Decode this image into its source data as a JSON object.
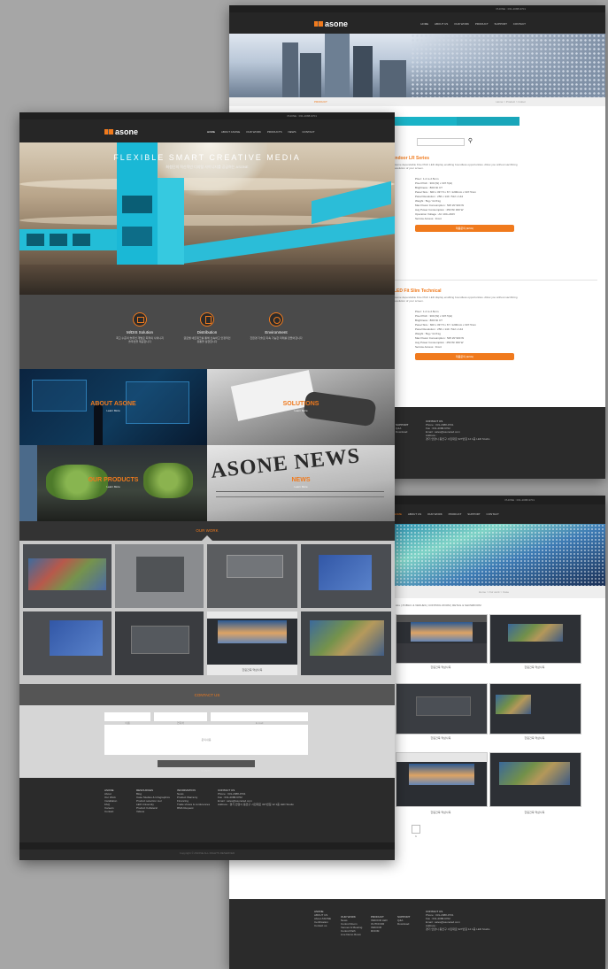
{
  "top_right_page": {
    "phone_bar": "PHONE : 031-2088-9701",
    "logo_word": "asone",
    "nav": [
      "HOME",
      "ABOUT US",
      "OUR WORK",
      "PRODUCT",
      "SUPPORT",
      "CONTACT"
    ],
    "breadcrumb_left": "PRODUCT",
    "breadcrumb_right": "Home > Product > Indoor",
    "tabs": [
      "INDOOR",
      "OUTDOOR"
    ],
    "product1_title": "Indoor LR Series",
    "product1_desc": "Asone dependable Fine Pitch LED display enabling boundless opportunities. Allow you without sacrificing resolution of your screen.",
    "product1_specs": [
      "Pixel : 1.2 to 2.5mm",
      "Pixel Pitch : 300 (W) x 337.5(H)",
      "Brightness : 800 Nit CT",
      "Panel Size : 600 x 337.5 x 67 / 1200mm x 337.5mm",
      "Panel Resolution : 256 x 144 / 512 x 144",
      "Weight : 5kg / 11.8 kg",
      "Max Power Consumption : 525 W/ 900 W",
      "Avg Power Consumption : 250 W/ 300 W",
      "Operation Voltage : AC 100~240V",
      "Service Access : Front"
    ],
    "product1_button": "제품문의 (ENG)",
    "product2_title": "LED Fit Slim Technical",
    "product2_desc": "Asone dependable Fine Pitch LED display enabling boundless opportunities. Allow you without sacrificing resolution of your screen.",
    "product2_specs": [
      "Pixel : 1.2 to 2.5mm",
      "Pixel Pitch : 300 (W) x 337.5(H)",
      "Brightness : 800 Nit CT",
      "Panel Size : 600 x 337.5 x 67 / 1200mm x 337.5mm",
      "Panel Resolution : 256 x 144 / 512 x 144",
      "Weight : 5kg / 11.8 kg",
      "Max Power Consumption : 525 W/ 900 W",
      "Avg Power Consumption : 250 W/ 300 W",
      "Service Access : Front"
    ],
    "product2_button": "제품문의 (ENG)",
    "footer_col1_title": "SUPPORT",
    "footer_col1_items": [
      "Q&A",
      "Download"
    ],
    "footer_col2_title": "CONTACT US",
    "footer_col2_items": [
      "Phone : 031-2088-9701",
      "Fax : 031-2088-9702",
      "Email : sales@asoneled.com",
      "Address :",
      "경기 안양시 동안구 시민대로 327번길 12 1층 LED Studio"
    ]
  },
  "bottom_right_page": {
    "phone_bar": "PHONE : 031-2088-9701",
    "nav": [
      "HOME",
      "ABOUT US",
      "OUR WORK",
      "PRODUCT",
      "SUPPORT",
      "CONTACT"
    ],
    "breadcrumb": "Home > Our work > Case",
    "filter_text": "ALL | PUBLIC & VENUES | CONTROL ROOM | RETAIL & SHOWROOM",
    "captions": [
      "한림건축 역삼사옥",
      "한림건축 역삼사옥",
      "한림건축 역삼사옥",
      "한림건축 역삼사옥",
      "한림건축 역삼사옥",
      "한림건축 역삼사옥"
    ],
    "pagination": "1",
    "footer_cols": [
      {
        "title": "ASONE",
        "items": [
          "ABOUT US",
          "About ASONE",
          "Certification",
          "Contact us"
        ]
      },
      {
        "title": "OUR WORK",
        "items": [
          "News",
          "Control Room",
          "Venues & Meeting",
          "Control Path",
          "Live Demo Room"
        ]
      },
      {
        "title": "PRODUCT",
        "items": [
          "INDOOR LED",
          "OUTDOOR",
          "INDOOR",
          "ROOM"
        ]
      },
      {
        "title": "SUPPORT",
        "items": [
          "Q&A",
          "Download"
        ]
      },
      {
        "title": "CONTACT US",
        "items": [
          "Phone : 031-2088-9701",
          "Fax : 031-2088-9702",
          "Email : sales@asoneled.com",
          "Address :",
          "경기 안양시 동안구 시민대로 327번길 12 1층 LED Studio"
        ]
      }
    ]
  },
  "main_page": {
    "phone_bar": "PHONE : 031-2088-9701",
    "logo_word": "asone",
    "nav": [
      "HOME",
      "ABOUT ASONE",
      "OUR WORK",
      "PRODUCTS",
      "NEWS",
      "CONTACT"
    ],
    "hero_title": "FLEXIBLE SMART CREATIVE MEDIA",
    "hero_sub": "최첨단의 혁신적인 디지털 사이니지를 공급하는 ASONE",
    "features": [
      {
        "title": "M/DIS Solution",
        "desc": "최고 수준의 솔루션 개발로 최적의 사이니지 솔루션을 제공합니다",
        "icon": "monitor-icon"
      },
      {
        "title": "Distribution",
        "desc": "글로벌 네트워크를 통해 신속하고 안정적인 유통을 실현합니다",
        "icon": "document-icon"
      },
      {
        "title": "Environment",
        "desc": "친환경 기술로 지속 가능한 미래를 만들어갑니다",
        "icon": "globe-icon"
      }
    ],
    "tiles": [
      {
        "label": "ABOUT ASONE",
        "more": "Learn More"
      },
      {
        "label": "SOLUTIONS",
        "more": "Learn More"
      },
      {
        "label": "OUR PRODUCTS",
        "more": "Learn More"
      },
      {
        "label": "NEWS",
        "more": "Learn More"
      }
    ],
    "news_heading": "ASONE NEWS",
    "our_work_label": "OUR WORK",
    "gallery_caption": "한림건축 역삼사옥",
    "contact_label": "CONTACT US",
    "contact_fields": [
      "이름",
      "연락처",
      "E-mail"
    ],
    "contact_message_placeholder": "문의내용",
    "contact_submit": "SUBMIT",
    "footer_cols": [
      {
        "title": "ASONE",
        "items": [
          "About",
          "Our Work",
          "Installation",
          "FAQ",
          "Careers",
          "Contact"
        ]
      },
      {
        "title": "RESOURCES",
        "items": [
          "Blog",
          "Case Studies & Infographics",
          "Product selection tool",
          "LED University",
          "Product Collateral",
          "Videos"
        ]
      },
      {
        "title": "INFORMATION",
        "items": [
          "News",
          "Product Warranty",
          "Financing",
          "Trade shows & conferences",
          "RMA Request"
        ]
      },
      {
        "title": "CONTACT US",
        "items": [
          "Phone : 031-2088-9701",
          "Fax : 031-2088-9702",
          "Email : sales@asoneled.com",
          "Address : 경기 안양시 동안구 시민대로 327번길 12 1층 LED Studio"
        ]
      }
    ],
    "copyright": "Copyright © ASONE ALL RIGHTS RESERVED"
  }
}
